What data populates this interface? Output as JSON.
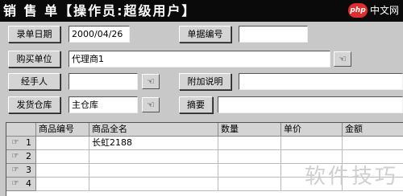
{
  "title": "销 售 单【操作员:超级用户】",
  "corner_logo": {
    "badge": "php",
    "text": "中文网"
  },
  "form": {
    "entry_date": {
      "label": "录单日期",
      "value": "2000/04/26"
    },
    "doc_number": {
      "label": "单据编号",
      "value": ""
    },
    "buyer": {
      "label": "购买单位",
      "value": "代理商1"
    },
    "handler": {
      "label": "经手人",
      "value": ""
    },
    "note": {
      "label": "附加说明",
      "value": ""
    },
    "warehouse": {
      "label": "发货仓库",
      "value": "主仓库"
    },
    "summary": {
      "label": "摘要",
      "value": ""
    }
  },
  "lookup_icon": "pointing-hand-icon",
  "table": {
    "columns": [
      "商品编号",
      "商品全名",
      "数量",
      "单价",
      "金额"
    ],
    "rows": [
      {
        "num": "1",
        "cells": [
          "",
          "长虹2188",
          "",
          "",
          ""
        ]
      },
      {
        "num": "2",
        "cells": [
          "",
          "",
          "",
          "",
          ""
        ]
      },
      {
        "num": "3",
        "cells": [
          "",
          "",
          "",
          "",
          ""
        ]
      },
      {
        "num": "4",
        "cells": [
          "",
          "",
          "",
          "",
          ""
        ]
      }
    ]
  },
  "watermark": "软件技巧"
}
